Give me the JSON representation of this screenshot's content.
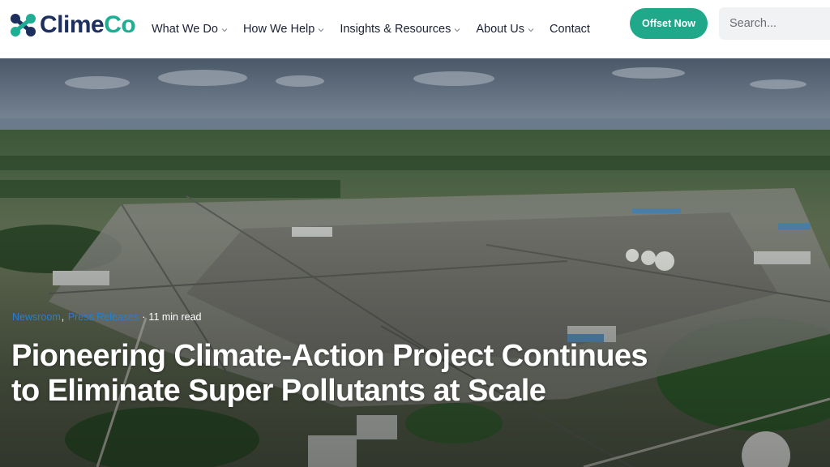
{
  "brand": {
    "name_part1": "Clime",
    "name_part2": "Co",
    "accent": "#1fa889",
    "navy": "#1c2f5e"
  },
  "nav": {
    "items": [
      {
        "label": "What We Do",
        "has_dropdown": true
      },
      {
        "label": "How We Help",
        "has_dropdown": true
      },
      {
        "label": "Insights & Resources",
        "has_dropdown": true
      },
      {
        "label": "About Us",
        "has_dropdown": true
      },
      {
        "label": "Contact",
        "has_dropdown": false
      }
    ],
    "cta_label": "Offset Now"
  },
  "search": {
    "placeholder": "Search..."
  },
  "hero": {
    "image_icon": "industrial-plant-aerial-photo",
    "category_1": "Newsroom",
    "category_2": "Press Releases",
    "read_time": "11 min read",
    "title": "Pioneering Climate-Action Project Continues to Eliminate Super Pollutants at Scale"
  }
}
